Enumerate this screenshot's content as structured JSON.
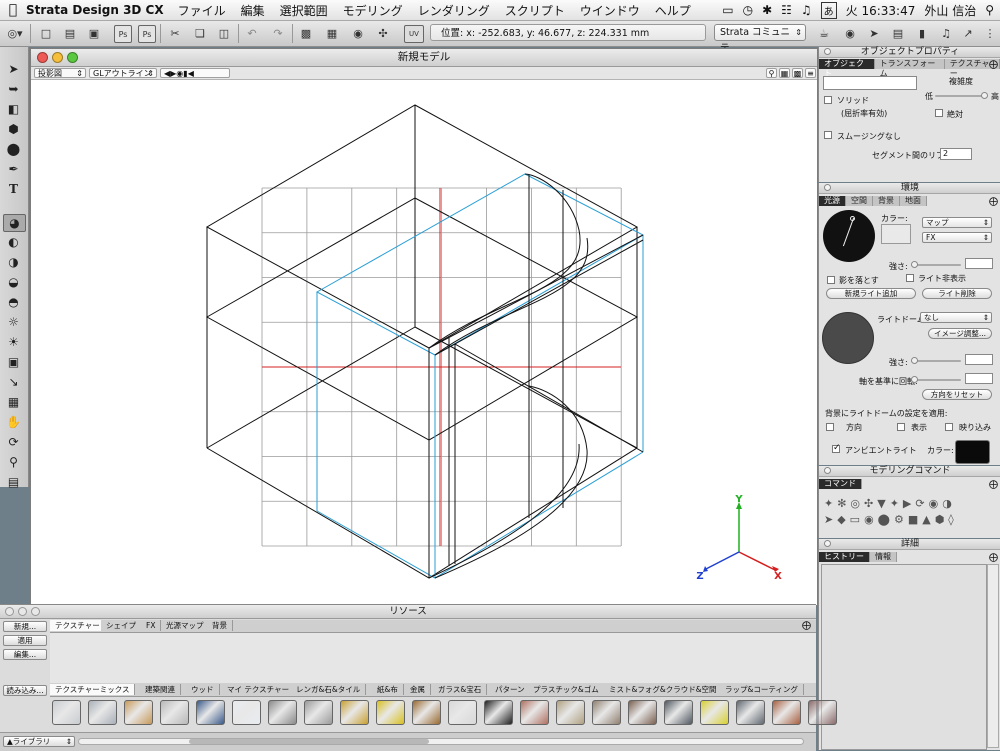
{
  "menubar": {
    "app_name": "Strata Design 3D CX",
    "items": [
      "ファイル",
      "編集",
      "選択範囲",
      "モデリング",
      "レンダリング",
      "スクリプト",
      "ウインドウ",
      "ヘルプ"
    ],
    "time": "火 16:33:47",
    "user": "外山 信治",
    "input_mode": "あ"
  },
  "toolbar": {
    "coords": "位置: x: -252.683, y: 46.677, z: 224.331 mm",
    "community": "Strata コミュニテ...",
    "ps_label": "Ps",
    "uv_label": "UV"
  },
  "main_window": {
    "title": "新規モデル",
    "projection": "投影図",
    "render_mode": "GLアウトライン"
  },
  "axes": {
    "x": "X",
    "y": "Y",
    "z": "Z",
    "x_color": "#d42020",
    "y_color": "#20b020",
    "z_color": "#2040d0"
  },
  "object_properties": {
    "title": "オブジェクトプロパティ",
    "tabs": [
      "オブジェクト",
      "トランスフォーム",
      "テクスチャー"
    ],
    "complexity": "複雑度",
    "low": "低",
    "high": "高",
    "solid": "ソリッド",
    "refraction": "(屈折率有効)",
    "absolute": "絶対",
    "smoothing": "スムージングなし",
    "segments_label": "セグメント間のリブ数:",
    "segments_value": "2"
  },
  "environment": {
    "title": "環境",
    "tabs": [
      "光源",
      "空間",
      "背景",
      "地面"
    ],
    "color_label": "カラー:",
    "map": "マップ",
    "fx": "FX",
    "strength": "強さ:",
    "cast_shadow": "影を落とす",
    "hide_light": "ライト非表示",
    "add_light": "新規ライト追加",
    "delete_light": "ライト削除",
    "light_dome": "ライトドーム:",
    "light_dome_value": "なし",
    "image_adjust": "イメージ調整...",
    "strength2": "強さ:",
    "rotate_axis": "軸を基準に回転:",
    "reset_direction": "方向をリセット",
    "apply_bg": "背景にライトドームの設定を適用:",
    "direction": "方向",
    "display": "表示",
    "reflection": "映り込み",
    "ambient": "アンビエントライト",
    "ambient_color_label": "カラー:"
  },
  "modeling_commands": {
    "title": "モデリングコマンド",
    "tab": "コマンド"
  },
  "details": {
    "title": "詳細",
    "tabs": [
      "ヒストリー",
      "情報"
    ]
  },
  "resources": {
    "title": "リソース",
    "buttons": [
      "新規...",
      "適用",
      "編集...",
      "読み込み..."
    ],
    "type_tabs": [
      "テクスチャー",
      "シェイプ",
      "FX",
      "光源マップ",
      "背景"
    ],
    "category_tabs": [
      "テクスチャーミックス",
      "建築関連",
      "ウッド",
      "マイ テクスチャー",
      "レンガ&石&タイル",
      "紙&布",
      "金属",
      "ガラス&宝石",
      "パターン",
      "プラスチック&ゴム",
      "ミスト&フォグ&クラウド&空間",
      "ラップ&コーティング"
    ],
    "library": "ライブラリ"
  },
  "swatches": [
    "#c8ccd0",
    "#a8b0b8",
    "#c89a5a",
    "#b8b8b8",
    "#3a5a8a",
    "#e8ecf0",
    "#8a8a8a",
    "#9a9a9a",
    "#c8a030",
    "#d8c020",
    "#9a6a30",
    "#d8d8d8",
    "#202020",
    "#b07060",
    "#b0a080",
    "#908070",
    "#7a6050",
    "#505860",
    "#d8d030",
    "#606870",
    "#a86040",
    "#8a6a6a"
  ]
}
